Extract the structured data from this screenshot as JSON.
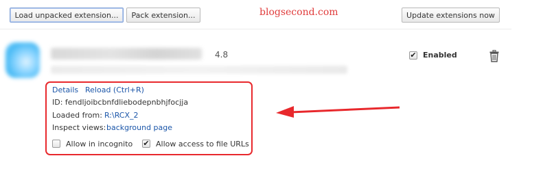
{
  "toolbar": {
    "load_unpacked": "Load unpacked extension...",
    "pack": "Pack extension...",
    "update": "Update extensions now"
  },
  "watermark": "blogsecond.com",
  "extension": {
    "version": "4.8",
    "enabled_label": "Enabled",
    "enabled": true,
    "details_link": "Details",
    "reload_link": "Reload (Ctrl+R)",
    "id_label": "ID:",
    "id_value": "fendljoibcbnfdliebodepnbhjfocjja",
    "loaded_from_label": "Loaded from:",
    "loaded_from_value": "R:\\RCX_2",
    "inspect_views_label": "Inspect views:",
    "inspect_views_value": "background page",
    "allow_incognito_label": "Allow in incognito",
    "allow_incognito": false,
    "allow_file_urls_label": "Allow access to file URLs",
    "allow_file_urls": true
  },
  "icons": {
    "delete": "trash-icon",
    "annotation": "red-arrow-icon"
  },
  "colors": {
    "link": "#1a55a8",
    "annotation": "#e8282c",
    "watermark": "#e03a3a"
  }
}
